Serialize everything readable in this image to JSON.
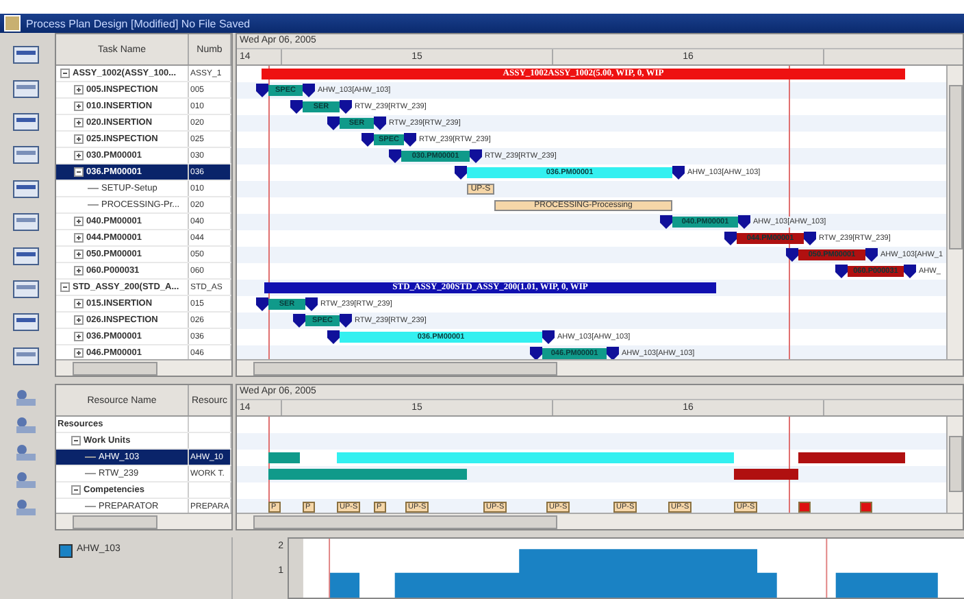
{
  "window": {
    "title": "Process Plan Design [Modified] No File Saved"
  },
  "task_table": {
    "columns": [
      "Task Name",
      "Numb"
    ],
    "rows": [
      {
        "name": "ASSY_1002(ASSY_100...",
        "number": "ASSY_1",
        "expanded": true,
        "selected": false,
        "children": [
          {
            "name": "005.INSPECTION",
            "number": "005",
            "expanded": false,
            "selected": false
          },
          {
            "name": "010.INSERTION",
            "number": "010",
            "expanded": false,
            "selected": false
          },
          {
            "name": "020.INSERTION",
            "number": "020",
            "expanded": false,
            "selected": false
          },
          {
            "name": "025.INSPECTION",
            "number": "025",
            "expanded": false,
            "selected": false
          },
          {
            "name": "030.PM00001",
            "number": "030",
            "expanded": false,
            "selected": false
          },
          {
            "name": "036.PM00001",
            "number": "036",
            "expanded": true,
            "selected": true,
            "children": [
              {
                "name": "SETUP-Setup",
                "number": "010",
                "selected": false
              },
              {
                "name": "PROCESSING-Pr...",
                "number": "020",
                "selected": false
              }
            ]
          },
          {
            "name": "040.PM00001",
            "number": "040",
            "expanded": false,
            "selected": false
          },
          {
            "name": "044.PM00001",
            "number": "044",
            "expanded": false,
            "selected": false
          },
          {
            "name": "050.PM00001",
            "number": "050",
            "expanded": false,
            "selected": false
          },
          {
            "name": "060.P000031",
            "number": "060",
            "expanded": false,
            "selected": false
          }
        ]
      },
      {
        "name": "STD_ASSY_200(STD_A...",
        "number": "STD_AS",
        "expanded": true,
        "selected": false,
        "children": [
          {
            "name": "015.INSERTION",
            "number": "015",
            "expanded": false,
            "selected": false
          },
          {
            "name": "026.INSPECTION",
            "number": "026",
            "expanded": false,
            "selected": false
          },
          {
            "name": "036.PM00001",
            "number": "036",
            "expanded": false,
            "selected": false
          },
          {
            "name": "046.PM00001",
            "number": "046",
            "expanded": false,
            "selected": false
          }
        ]
      }
    ]
  },
  "task_gantt": {
    "date": "Wed Apr 06, 2005",
    "days": [
      "14",
      "15",
      "16"
    ],
    "rows": [
      {
        "label": "ASSY_1002ASSY_1002(5.00, WIP, 0, WIP",
        "color": "#ee1111"
      },
      {
        "label": "SPEC",
        "color": "#109a8a",
        "resource": "AHW_103[AHW_103]"
      },
      {
        "label": "SER",
        "color": "#109a8a",
        "resource": "RTW_239[RTW_239]"
      },
      {
        "label": "SER",
        "color": "#109a8a",
        "resource": "RTW_239[RTW_239]"
      },
      {
        "label": "SPEC",
        "color": "#109a8a",
        "resource": "RTW_239[RTW_239]"
      },
      {
        "label": "030.PM00001",
        "color": "#109a8a",
        "resource": "RTW_239[RTW_239]"
      },
      {
        "label": "036.PM00001",
        "color": "#33f0f0",
        "resource": "AHW_103[AHW_103]"
      },
      {
        "label": "UP-S",
        "color": "#f5d6a8"
      },
      {
        "label": "PROCESSING-Processing",
        "color": "#f5d6a8"
      },
      {
        "label": "040.PM00001",
        "color": "#109a8a",
        "resource": "AHW_103[AHW_103]"
      },
      {
        "label": "044.PM00001",
        "color": "#b01010",
        "resource": "RTW_239[RTW_239]"
      },
      {
        "label": "050.PM00001",
        "color": "#b01010",
        "resource": "AHW_103[AHW_1"
      },
      {
        "label": "060.P000031",
        "color": "#b01010",
        "resource": "AHW_"
      },
      {
        "label": "STD_ASSY_200STD_ASSY_200(1.01, WIP, 0, WIP",
        "color": "#1010b0"
      },
      {
        "label": "SER",
        "color": "#109a8a",
        "resource": "RTW_239[RTW_239]"
      },
      {
        "label": "SPEC",
        "color": "#109a8a",
        "resource": "RTW_239[RTW_239]"
      },
      {
        "label": "036.PM00001",
        "color": "#33f0f0",
        "resource": "AHW_103[AHW_103]"
      },
      {
        "label": "046.PM00001",
        "color": "#109a8a",
        "resource": "AHW_103[AHW_103]"
      }
    ]
  },
  "resource_table": {
    "columns": [
      "Resource Name",
      "Resourc"
    ],
    "rows": [
      {
        "name": "Resources",
        "selected": false,
        "children": [
          {
            "name": "Work Units",
            "expanded": true,
            "selected": false,
            "children": [
              {
                "name": "AHW_103",
                "type": "AHW_10",
                "selected": true
              },
              {
                "name": "RTW_239",
                "type": "WORK T.",
                "selected": false
              }
            ]
          },
          {
            "name": "Competencies",
            "expanded": true,
            "selected": false,
            "children": [
              {
                "name": "PREPARATOR",
                "type": "PREPARA",
                "selected": false
              }
            ]
          }
        ]
      }
    ]
  },
  "resource_gantt": {
    "date": "Wed Apr 06, 2005",
    "days": [
      "14",
      "15",
      "16"
    ],
    "preparator_bars": [
      {
        "label": "P",
        "color": "#f5d6a8"
      },
      {
        "label": "P",
        "color": "#f5d6a8"
      },
      {
        "label": "UP-S",
        "color": "#f5d6a8"
      },
      {
        "label": "P",
        "color": "#f5d6a8"
      },
      {
        "label": "UP-S",
        "color": "#f5d6a8"
      },
      {
        "label": "UP-S",
        "color": "#f5d6a8"
      },
      {
        "label": "UP-S",
        "color": "#f5d6a8"
      },
      {
        "label": "UP-S",
        "color": "#f5d6a8"
      },
      {
        "label": "UP-S",
        "color": "#f5d6a8"
      },
      {
        "label": "UP-S",
        "color": "#f5d6a8"
      },
      {
        "color": "#dd1111"
      },
      {
        "color": "#dd1111"
      }
    ]
  },
  "histogram": {
    "legend": "AHW_103",
    "yticks": [
      "2",
      "1"
    ]
  }
}
